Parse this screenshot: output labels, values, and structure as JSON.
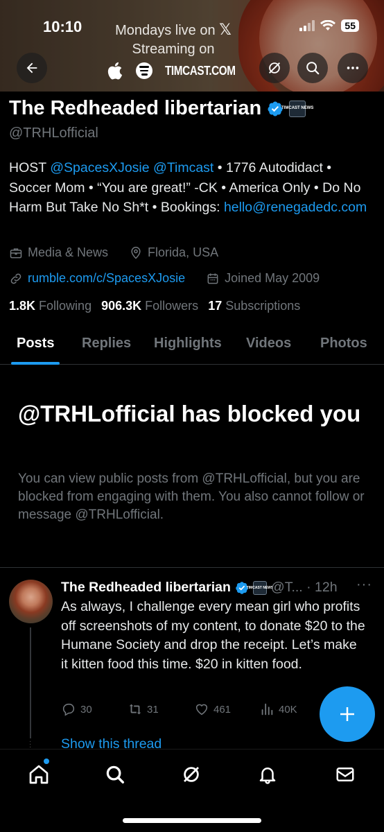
{
  "status_bar": {
    "time": "10:10",
    "battery": "55"
  },
  "banner": {
    "line1": "Mondays live on",
    "line1_logo": "𝕏",
    "line2": "Streaming on",
    "brand": "TIMCAST.COM"
  },
  "profile": {
    "name": "The Redheaded libertarian",
    "affiliate_badge": "TIMCAST NEWS",
    "handle": "@TRHLofficial",
    "bio": {
      "host": "HOST ",
      "mention1": "@SpacesXJosie",
      "sp1": " ",
      "mention2": "@Timcast",
      "rest": " • 1776 Autodidact • Soccer Mom • “You are great!” -CK • America Only • Do No Harm But Take No Sh*t • Bookings: ",
      "email": "hello@renegadedc.com"
    },
    "category": "Media & News",
    "location": "Florida, USA",
    "website": "rumble.com/c/SpacesXJosie",
    "joined": "Joined May 2009",
    "following_count": "1.8K",
    "following_label": "Following",
    "followers_count": "906.3K",
    "followers_label": "Followers",
    "subscriptions_count": "17",
    "subscriptions_label": "Subscriptions"
  },
  "tabs": [
    "Posts",
    "Replies",
    "Highlights",
    "Videos",
    "Photos"
  ],
  "blocked": {
    "title": "@TRHLofficial has blocked you",
    "description": "You can view public posts from @TRHLofficial, but you are blocked from engaging with them. You also cannot follow or message @TRHLofficial."
  },
  "tweet": {
    "name": "The Redheaded libertarian",
    "handle_time": "@T... · 12h",
    "text": "As always, I challenge every mean girl who profits off screenshots of my content, to donate $20 to the Humane Society and drop the receipt. Let’s make it kitten food this time. $20 in kitten food.",
    "replies": "30",
    "reposts": "31",
    "likes": "461",
    "views": "40K",
    "show_thread": "Show this thread"
  },
  "colors": {
    "accent": "#1d9bf0",
    "muted": "#71767b",
    "background": "#000000"
  }
}
